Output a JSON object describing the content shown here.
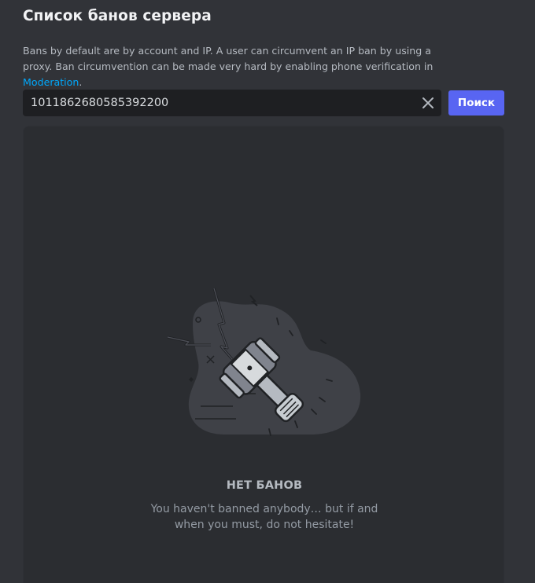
{
  "header": {
    "title": "Список банов сервера"
  },
  "description": {
    "text": "Bans by default are by account and IP. A user can circumvent an IP ban by using a proxy. Ban circumvention can be made very hard by enabling phone verification in ",
    "link": "Moderation",
    "suffix": "."
  },
  "search": {
    "value": "1011862680585392200",
    "placeholder": ""
  },
  "search_button": {
    "label": "Поиск"
  },
  "empty_state": {
    "title": "НЕТ БАНОВ",
    "text": "You haven't banned anybody… but if and when you must, do not hesitate!"
  },
  "colors": {
    "background": "#313338",
    "panel": "#2b2d31",
    "input": "#1e1f22",
    "accent": "#5865f2",
    "link": "#00a8fc"
  },
  "icons": {
    "clear": "close-icon",
    "illustration": "ban-hammer-illustration"
  }
}
